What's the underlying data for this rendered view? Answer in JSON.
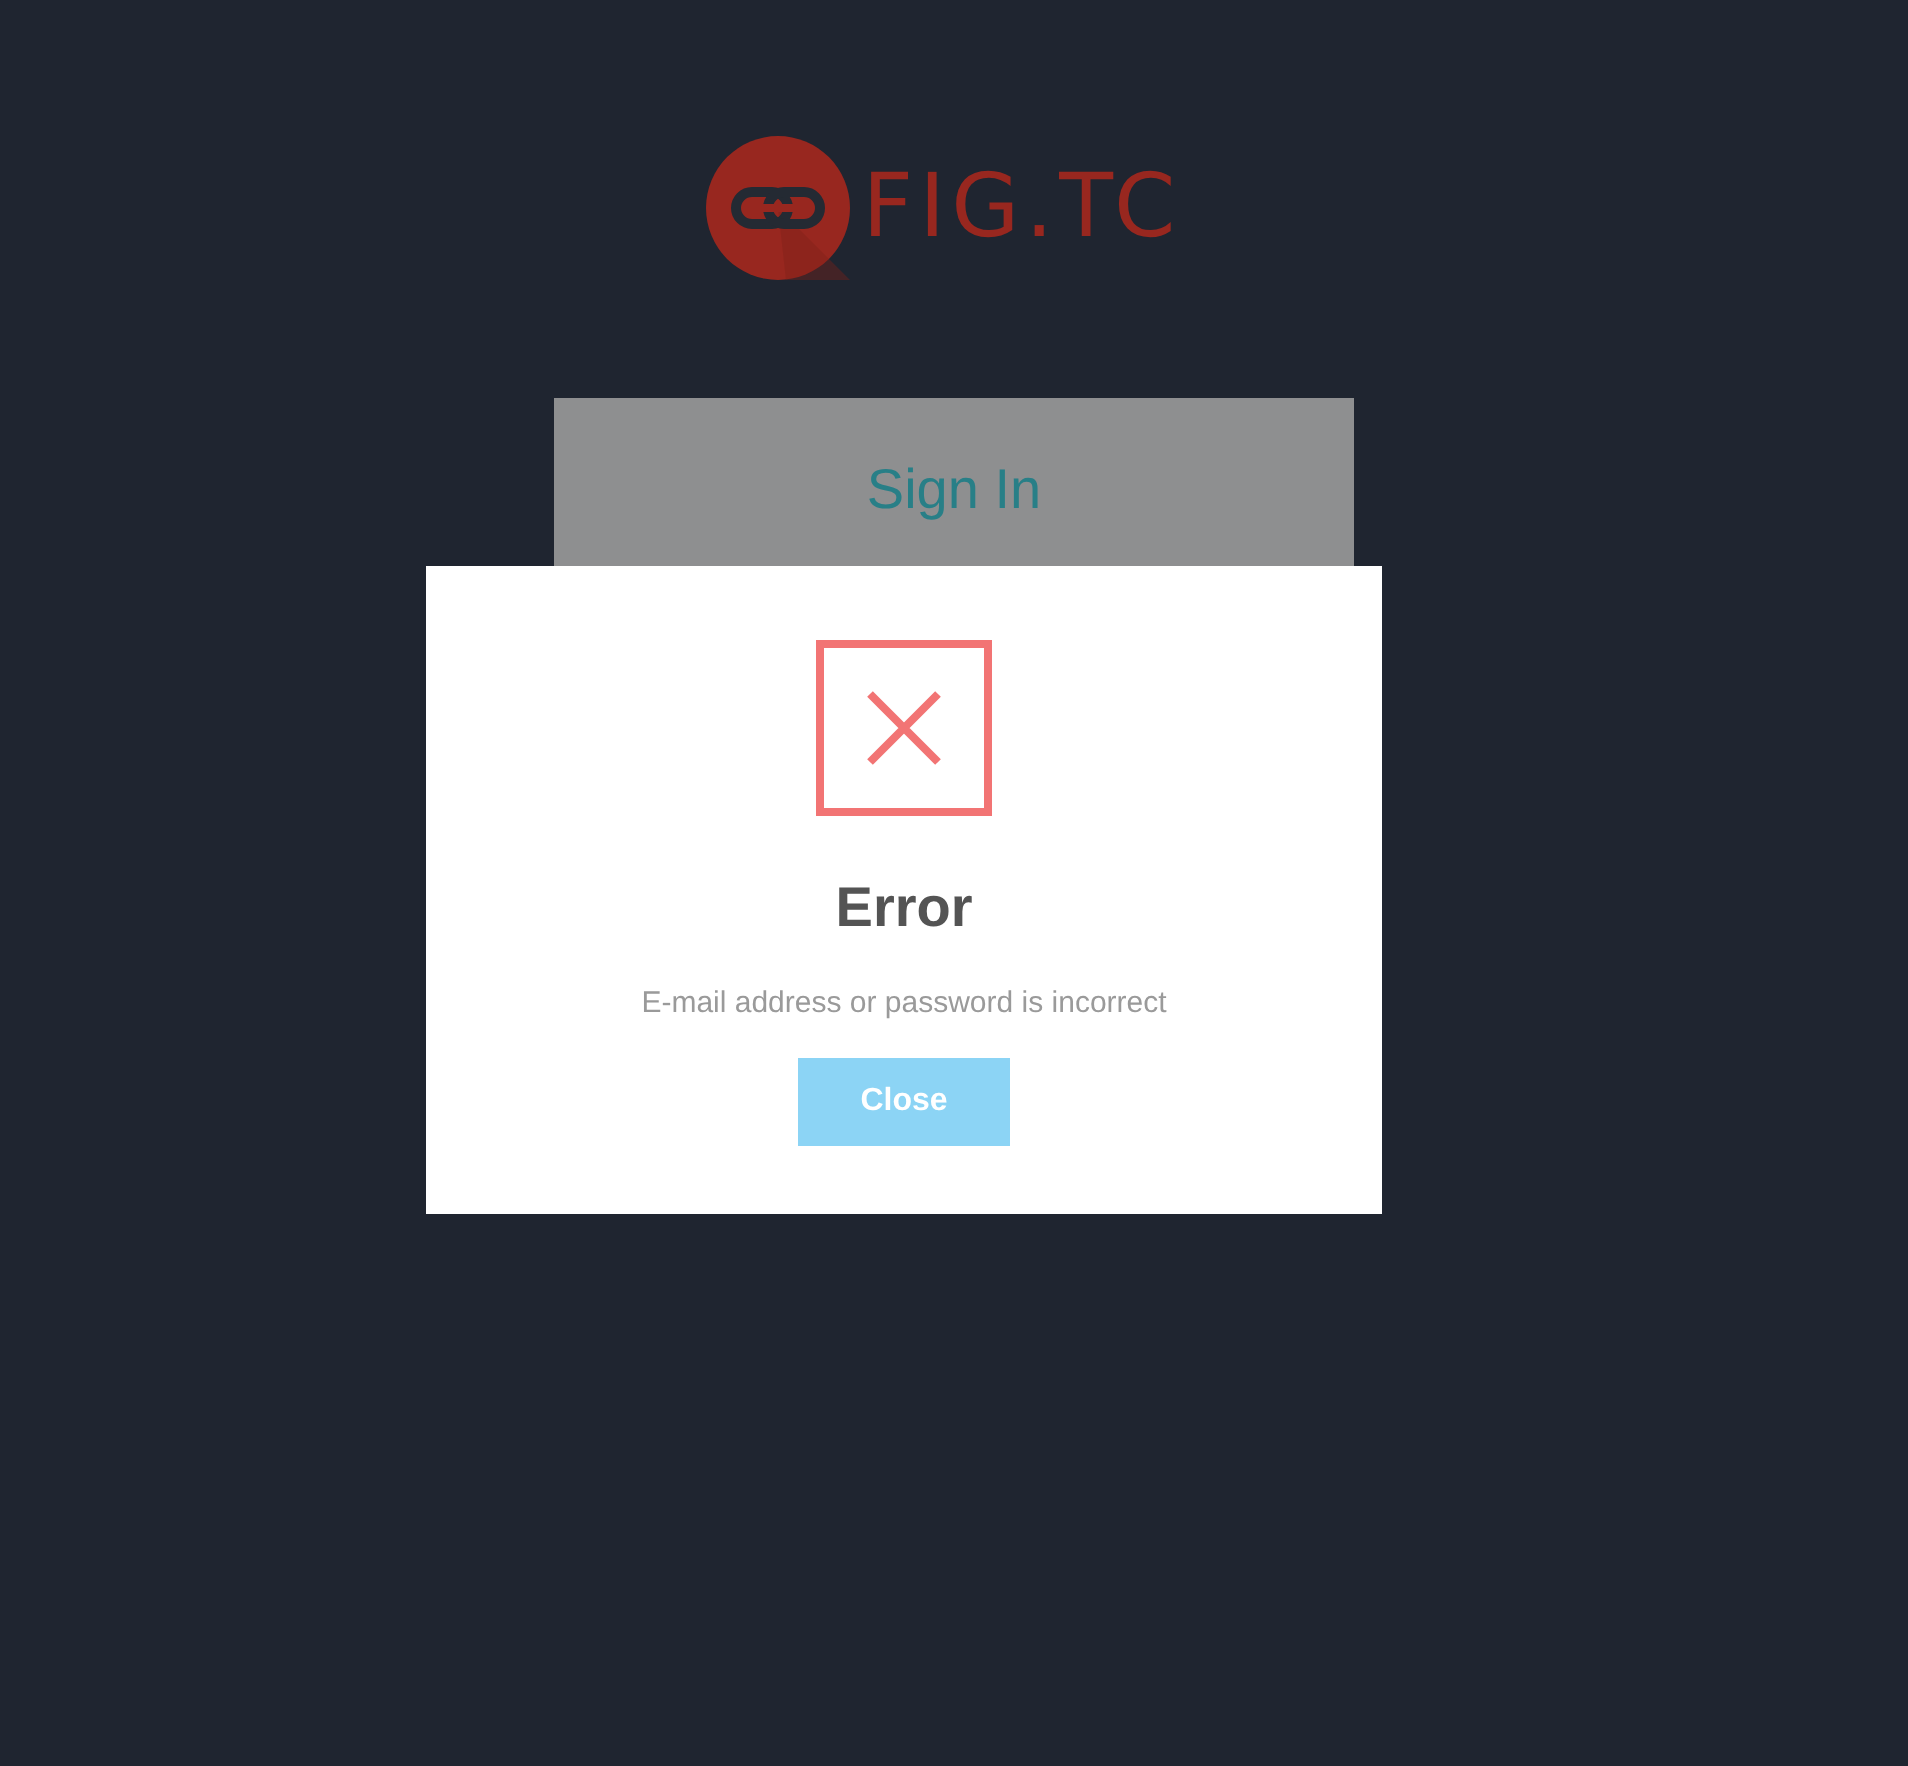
{
  "logo": {
    "text": "FIG.TC"
  },
  "card": {
    "title": "Sign In"
  },
  "dialog": {
    "kind": "error",
    "title": "Error",
    "message": "E-mail address or password is incorrect",
    "buttons": [
      "Close"
    ]
  }
}
